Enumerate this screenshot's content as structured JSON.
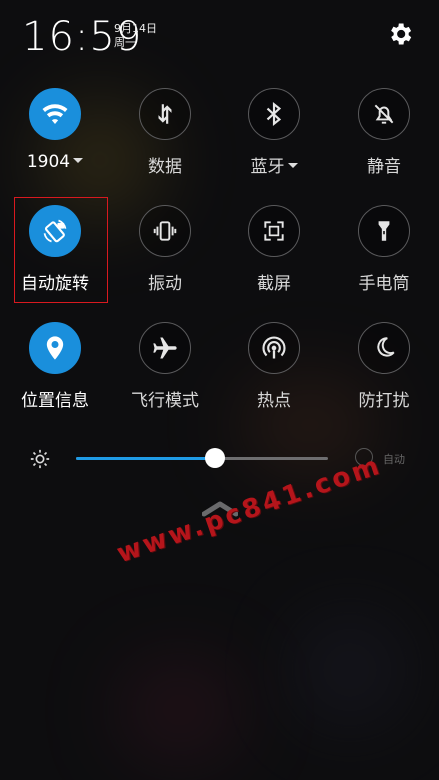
{
  "status": {
    "time": "16:59",
    "date": "9月14日",
    "weekday": "周一"
  },
  "tiles": {
    "wifi": {
      "label": "1904",
      "icon": "wifi-icon",
      "active": true
    },
    "data": {
      "label": "数据",
      "icon": "data-transfer-icon",
      "active": false
    },
    "bluetooth": {
      "label": "蓝牙",
      "icon": "bluetooth-icon",
      "active": false
    },
    "mute": {
      "label": "静音",
      "icon": "bell-off-icon",
      "active": false
    },
    "autorotate": {
      "label": "自动旋转",
      "icon": "rotate-lock-icon",
      "active": true
    },
    "vibrate": {
      "label": "振动",
      "icon": "vibrate-icon",
      "active": false
    },
    "screenshot": {
      "label": "截屏",
      "icon": "screenshot-icon",
      "active": false
    },
    "flashlight": {
      "label": "手电筒",
      "icon": "flashlight-icon",
      "active": false
    },
    "location": {
      "label": "位置信息",
      "icon": "location-pin-icon",
      "active": true
    },
    "airplane": {
      "label": "飞行模式",
      "icon": "airplane-icon",
      "active": false
    },
    "hotspot": {
      "label": "热点",
      "icon": "hotspot-icon",
      "active": false
    },
    "dnd": {
      "label": "防打扰",
      "icon": "moon-icon",
      "active": false
    }
  },
  "brightness": {
    "level": 0.55,
    "auto_label": "自动",
    "auto_checked": false
  },
  "watermark": "www.pc841.com",
  "colors": {
    "accent": "#1a8fdc",
    "highlight": "#d8191f",
    "watermark": "#b5151b"
  }
}
